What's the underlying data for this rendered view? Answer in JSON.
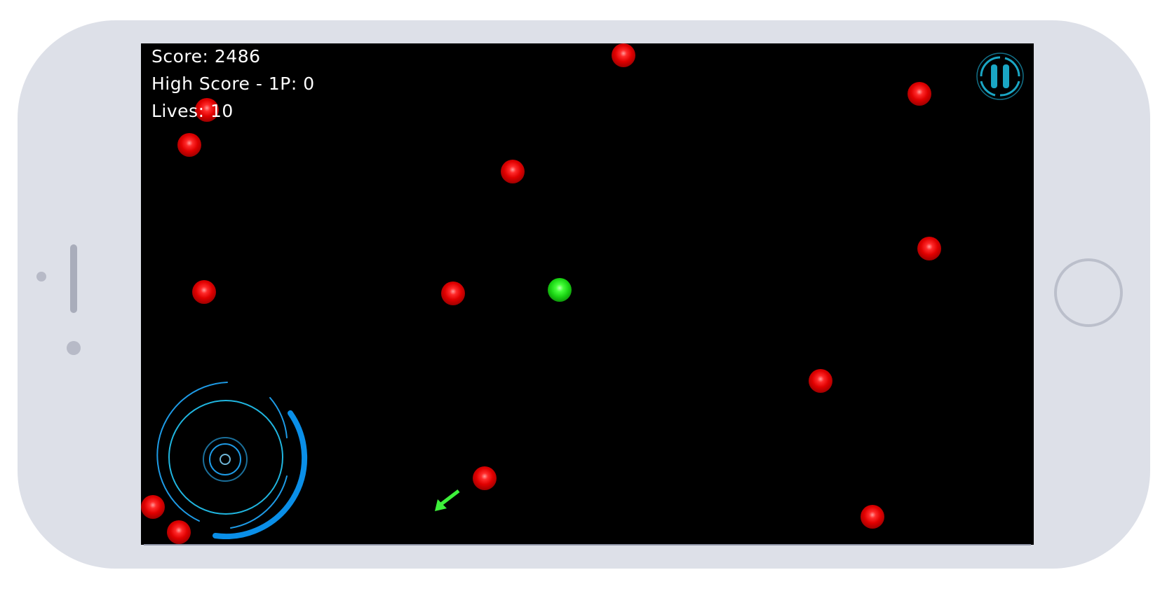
{
  "hud": {
    "score": "Score: 2486",
    "high_score": "High Score - 1P: 0",
    "lives": "Lives: 10"
  },
  "game": {
    "player": {
      "color": "green"
    },
    "enemy_color": "red",
    "enemy_count": 14,
    "direction_indicator": "arrow-down-left"
  },
  "controls": {
    "pause_icon": "pause-icon",
    "joystick_icon": "joystick-icon"
  },
  "colors": {
    "screen_background": "#000000",
    "hud_text": "#ffffff",
    "accent_blue": "#1e9be6",
    "pause_teal": "#1aa6c4",
    "enemy": "#e00000",
    "player": "#2ee02a",
    "device_frame": "#dde0e8"
  }
}
